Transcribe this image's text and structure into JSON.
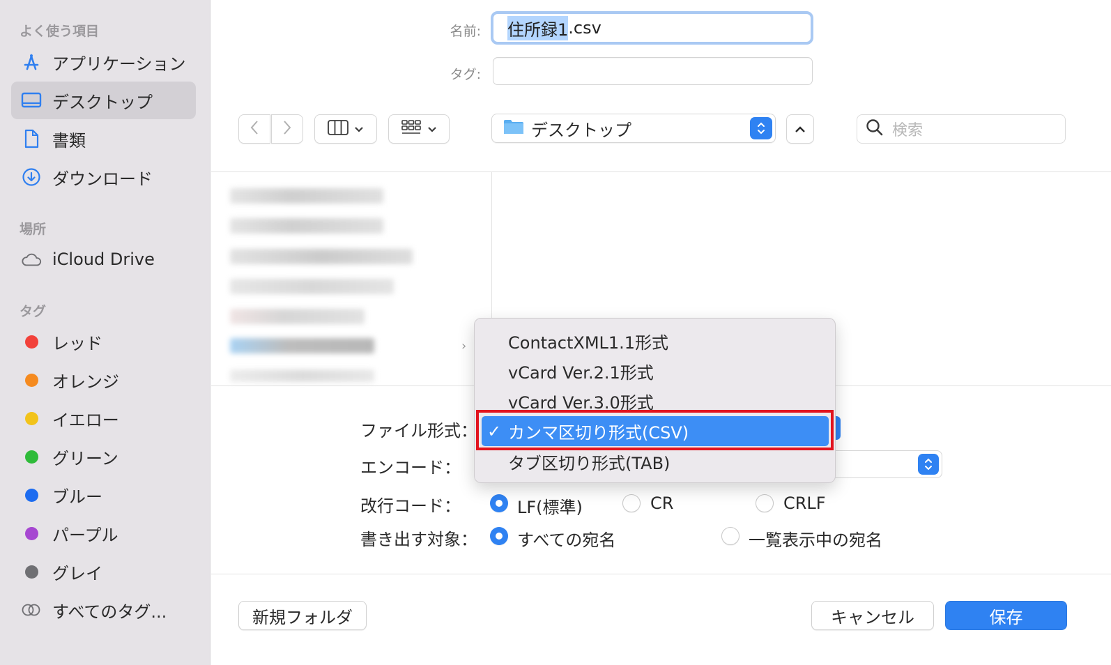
{
  "sidebar": {
    "favorites_heading": "よく使う項目",
    "favorites": [
      {
        "label": "アプリケーション",
        "icon": "applications-icon"
      },
      {
        "label": "デスクトップ",
        "icon": "desktop-icon",
        "selected": true
      },
      {
        "label": "書類",
        "icon": "document-icon"
      },
      {
        "label": "ダウンロード",
        "icon": "download-icon"
      }
    ],
    "locations_heading": "場所",
    "locations": [
      {
        "label": "iCloud Drive",
        "icon": "cloud-icon"
      }
    ],
    "tags_heading": "タグ",
    "tags": [
      {
        "label": "レッド",
        "color": "#f2413a"
      },
      {
        "label": "オレンジ",
        "color": "#f58a1f"
      },
      {
        "label": "イエロー",
        "color": "#f2c31a"
      },
      {
        "label": "グリーン",
        "color": "#2fbb3a"
      },
      {
        "label": "ブルー",
        "color": "#1d6cf0"
      },
      {
        "label": "パープル",
        "color": "#a647d1"
      },
      {
        "label": "グレイ",
        "color": "#6f6f73"
      }
    ],
    "all_tags": "すべてのタグ..."
  },
  "form": {
    "name_label": "名前:",
    "name_selected": "住所録1",
    "name_ext": ".csv",
    "tag_label": "タグ:"
  },
  "toolbar": {
    "location": "デスクトップ",
    "search_placeholder": "検索"
  },
  "options": {
    "file_format_label": "ファイル形式：",
    "encode_label": "エンコード：",
    "newline_label": "改行コード：",
    "newline_options": [
      {
        "label": "LF(標準)",
        "selected": true
      },
      {
        "label": "CR",
        "selected": false
      },
      {
        "label": "CRLF",
        "selected": false
      }
    ],
    "export_label": "書き出す対象：",
    "export_options": [
      {
        "label": "すべての宛名",
        "selected": true
      },
      {
        "label": "一覧表示中の宛名",
        "selected": false
      }
    ]
  },
  "format_menu": {
    "items": [
      {
        "label": "ContactXML1.1形式"
      },
      {
        "label": "vCard Ver.2.1形式"
      },
      {
        "label": "vCard Ver.3.0形式"
      },
      {
        "label": "カンマ区切り形式(CSV)",
        "selected": true
      },
      {
        "label": "タブ区切り形式(TAB)"
      }
    ],
    "checkmark": "✓"
  },
  "buttons": {
    "new_folder": "新規フォルダ",
    "cancel": "キャンセル",
    "save": "保存"
  },
  "colors": {
    "accent": "#2f82f2",
    "highlight_border": "#e2141e"
  }
}
